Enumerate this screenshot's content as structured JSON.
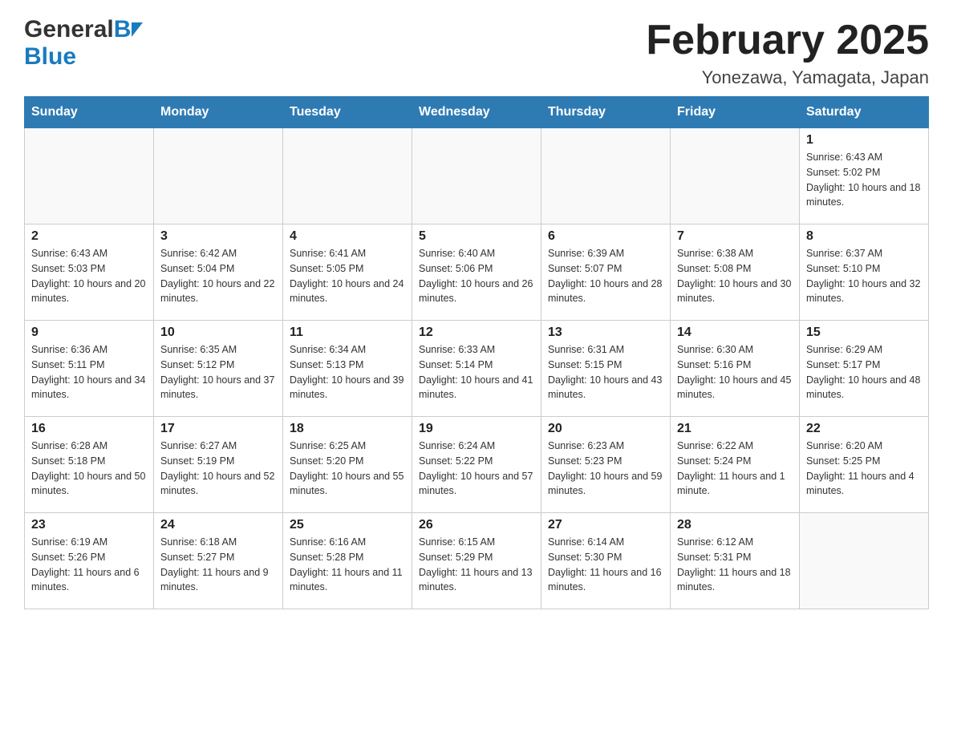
{
  "header": {
    "title": "February 2025",
    "subtitle": "Yonezawa, Yamagata, Japan",
    "logo_general": "General",
    "logo_blue": "Blue"
  },
  "days_of_week": [
    "Sunday",
    "Monday",
    "Tuesday",
    "Wednesday",
    "Thursday",
    "Friday",
    "Saturday"
  ],
  "weeks": [
    [
      {
        "day": "",
        "sunrise": "",
        "sunset": "",
        "daylight": ""
      },
      {
        "day": "",
        "sunrise": "",
        "sunset": "",
        "daylight": ""
      },
      {
        "day": "",
        "sunrise": "",
        "sunset": "",
        "daylight": ""
      },
      {
        "day": "",
        "sunrise": "",
        "sunset": "",
        "daylight": ""
      },
      {
        "day": "",
        "sunrise": "",
        "sunset": "",
        "daylight": ""
      },
      {
        "day": "",
        "sunrise": "",
        "sunset": "",
        "daylight": ""
      },
      {
        "day": "1",
        "sunrise": "Sunrise: 6:43 AM",
        "sunset": "Sunset: 5:02 PM",
        "daylight": "Daylight: 10 hours and 18 minutes."
      }
    ],
    [
      {
        "day": "2",
        "sunrise": "Sunrise: 6:43 AM",
        "sunset": "Sunset: 5:03 PM",
        "daylight": "Daylight: 10 hours and 20 minutes."
      },
      {
        "day": "3",
        "sunrise": "Sunrise: 6:42 AM",
        "sunset": "Sunset: 5:04 PM",
        "daylight": "Daylight: 10 hours and 22 minutes."
      },
      {
        "day": "4",
        "sunrise": "Sunrise: 6:41 AM",
        "sunset": "Sunset: 5:05 PM",
        "daylight": "Daylight: 10 hours and 24 minutes."
      },
      {
        "day": "5",
        "sunrise": "Sunrise: 6:40 AM",
        "sunset": "Sunset: 5:06 PM",
        "daylight": "Daylight: 10 hours and 26 minutes."
      },
      {
        "day": "6",
        "sunrise": "Sunrise: 6:39 AM",
        "sunset": "Sunset: 5:07 PM",
        "daylight": "Daylight: 10 hours and 28 minutes."
      },
      {
        "day": "7",
        "sunrise": "Sunrise: 6:38 AM",
        "sunset": "Sunset: 5:08 PM",
        "daylight": "Daylight: 10 hours and 30 minutes."
      },
      {
        "day": "8",
        "sunrise": "Sunrise: 6:37 AM",
        "sunset": "Sunset: 5:10 PM",
        "daylight": "Daylight: 10 hours and 32 minutes."
      }
    ],
    [
      {
        "day": "9",
        "sunrise": "Sunrise: 6:36 AM",
        "sunset": "Sunset: 5:11 PM",
        "daylight": "Daylight: 10 hours and 34 minutes."
      },
      {
        "day": "10",
        "sunrise": "Sunrise: 6:35 AM",
        "sunset": "Sunset: 5:12 PM",
        "daylight": "Daylight: 10 hours and 37 minutes."
      },
      {
        "day": "11",
        "sunrise": "Sunrise: 6:34 AM",
        "sunset": "Sunset: 5:13 PM",
        "daylight": "Daylight: 10 hours and 39 minutes."
      },
      {
        "day": "12",
        "sunrise": "Sunrise: 6:33 AM",
        "sunset": "Sunset: 5:14 PM",
        "daylight": "Daylight: 10 hours and 41 minutes."
      },
      {
        "day": "13",
        "sunrise": "Sunrise: 6:31 AM",
        "sunset": "Sunset: 5:15 PM",
        "daylight": "Daylight: 10 hours and 43 minutes."
      },
      {
        "day": "14",
        "sunrise": "Sunrise: 6:30 AM",
        "sunset": "Sunset: 5:16 PM",
        "daylight": "Daylight: 10 hours and 45 minutes."
      },
      {
        "day": "15",
        "sunrise": "Sunrise: 6:29 AM",
        "sunset": "Sunset: 5:17 PM",
        "daylight": "Daylight: 10 hours and 48 minutes."
      }
    ],
    [
      {
        "day": "16",
        "sunrise": "Sunrise: 6:28 AM",
        "sunset": "Sunset: 5:18 PM",
        "daylight": "Daylight: 10 hours and 50 minutes."
      },
      {
        "day": "17",
        "sunrise": "Sunrise: 6:27 AM",
        "sunset": "Sunset: 5:19 PM",
        "daylight": "Daylight: 10 hours and 52 minutes."
      },
      {
        "day": "18",
        "sunrise": "Sunrise: 6:25 AM",
        "sunset": "Sunset: 5:20 PM",
        "daylight": "Daylight: 10 hours and 55 minutes."
      },
      {
        "day": "19",
        "sunrise": "Sunrise: 6:24 AM",
        "sunset": "Sunset: 5:22 PM",
        "daylight": "Daylight: 10 hours and 57 minutes."
      },
      {
        "day": "20",
        "sunrise": "Sunrise: 6:23 AM",
        "sunset": "Sunset: 5:23 PM",
        "daylight": "Daylight: 10 hours and 59 minutes."
      },
      {
        "day": "21",
        "sunrise": "Sunrise: 6:22 AM",
        "sunset": "Sunset: 5:24 PM",
        "daylight": "Daylight: 11 hours and 1 minute."
      },
      {
        "day": "22",
        "sunrise": "Sunrise: 6:20 AM",
        "sunset": "Sunset: 5:25 PM",
        "daylight": "Daylight: 11 hours and 4 minutes."
      }
    ],
    [
      {
        "day": "23",
        "sunrise": "Sunrise: 6:19 AM",
        "sunset": "Sunset: 5:26 PM",
        "daylight": "Daylight: 11 hours and 6 minutes."
      },
      {
        "day": "24",
        "sunrise": "Sunrise: 6:18 AM",
        "sunset": "Sunset: 5:27 PM",
        "daylight": "Daylight: 11 hours and 9 minutes."
      },
      {
        "day": "25",
        "sunrise": "Sunrise: 6:16 AM",
        "sunset": "Sunset: 5:28 PM",
        "daylight": "Daylight: 11 hours and 11 minutes."
      },
      {
        "day": "26",
        "sunrise": "Sunrise: 6:15 AM",
        "sunset": "Sunset: 5:29 PM",
        "daylight": "Daylight: 11 hours and 13 minutes."
      },
      {
        "day": "27",
        "sunrise": "Sunrise: 6:14 AM",
        "sunset": "Sunset: 5:30 PM",
        "daylight": "Daylight: 11 hours and 16 minutes."
      },
      {
        "day": "28",
        "sunrise": "Sunrise: 6:12 AM",
        "sunset": "Sunset: 5:31 PM",
        "daylight": "Daylight: 11 hours and 18 minutes."
      },
      {
        "day": "",
        "sunrise": "",
        "sunset": "",
        "daylight": ""
      }
    ]
  ]
}
